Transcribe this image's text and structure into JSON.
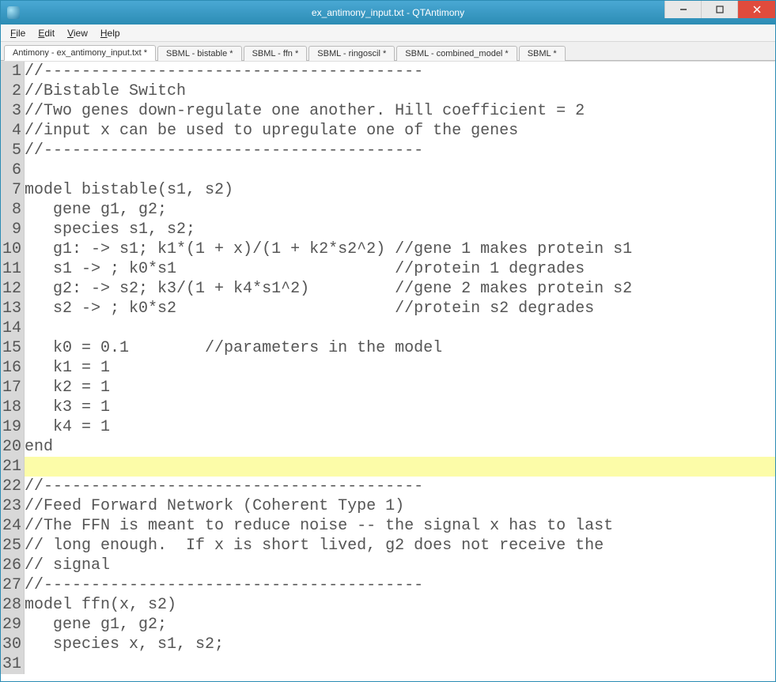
{
  "window": {
    "title": "ex_antimony_input.txt - QTAntimony",
    "controls": {
      "minimize": "–",
      "maximize": "▭",
      "close": "✕"
    }
  },
  "menu": {
    "file": {
      "label": "File",
      "accel": "F"
    },
    "edit": {
      "label": "Edit",
      "accel": "E"
    },
    "view": {
      "label": "View",
      "accel": "V"
    },
    "help": {
      "label": "Help",
      "accel": "H"
    }
  },
  "tabs": [
    {
      "label": "Antimony - ex_antimony_input.txt *",
      "active": true
    },
    {
      "label": "SBML - bistable *",
      "active": false
    },
    {
      "label": "SBML - ffn *",
      "active": false
    },
    {
      "label": "SBML - ringoscil *",
      "active": false
    },
    {
      "label": "SBML - combined_model *",
      "active": false
    },
    {
      "label": "SBML *",
      "active": false
    }
  ],
  "editor": {
    "highlighted_line": 21,
    "lines": [
      "//----------------------------------------",
      "//Bistable Switch",
      "//Two genes down-regulate one another. Hill coefficient = 2",
      "//input x can be used to upregulate one of the genes",
      "//----------------------------------------",
      "",
      "model bistable(s1, s2)",
      "   gene g1, g2;",
      "   species s1, s2;",
      "   g1: -> s1; k1*(1 + x)/(1 + k2*s2^2) //gene 1 makes protein s1",
      "   s1 -> ; k0*s1                       //protein 1 degrades",
      "   g2: -> s2; k3/(1 + k4*s1^2)         //gene 2 makes protein s2",
      "   s2 -> ; k0*s2                       //protein s2 degrades",
      "",
      "   k0 = 0.1        //parameters in the model",
      "   k1 = 1",
      "   k2 = 1",
      "   k3 = 1",
      "   k4 = 1",
      "end",
      "",
      "//----------------------------------------",
      "//Feed Forward Network (Coherent Type 1)",
      "//The FFN is meant to reduce noise -- the signal x has to last",
      "// long enough.  If x is short lived, g2 does not receive the ",
      "// signal",
      "//----------------------------------------",
      "model ffn(x, s2)",
      "   gene g1, g2;",
      "   species x, s1, s2;",
      ""
    ]
  }
}
